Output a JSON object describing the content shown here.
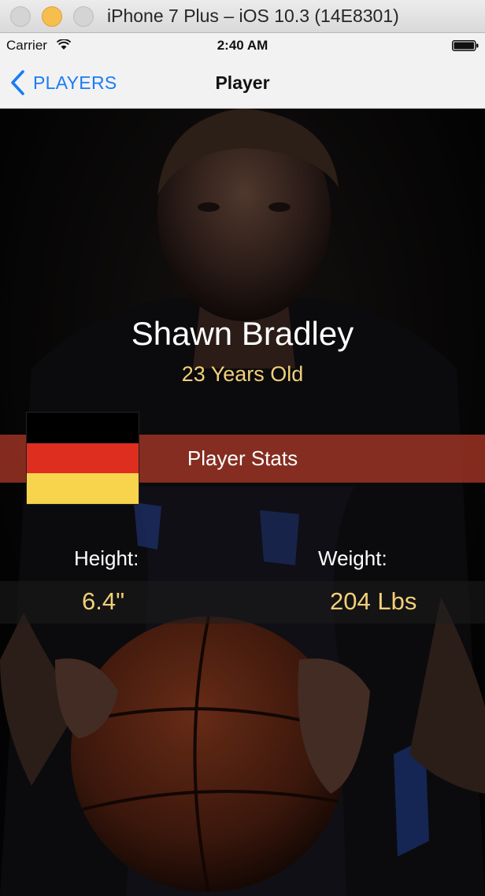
{
  "window": {
    "title": "iPhone 7 Plus – iOS 10.3 (14E8301)"
  },
  "statusbar": {
    "carrier": "Carrier",
    "time": "2:40 AM"
  },
  "navbar": {
    "back_label": "PLAYERS",
    "title": "Player"
  },
  "player": {
    "name": "Shawn Bradley",
    "age": "23 Years Old",
    "flag": {
      "country_colors": [
        "#000000",
        "#dd2e1f",
        "#f8d44c"
      ]
    }
  },
  "stats": {
    "title": "Player Stats",
    "height_label": "Height:",
    "height_value": "6.4\"",
    "weight_label": "Weight:",
    "weight_value": "204 Lbs"
  },
  "colors": {
    "accent": "#1a7cf5",
    "gold": "#f3cf78",
    "stats_band": "#a03424"
  },
  "icons": [
    "wifi-icon",
    "battery-icon",
    "chevron-left-icon"
  ]
}
